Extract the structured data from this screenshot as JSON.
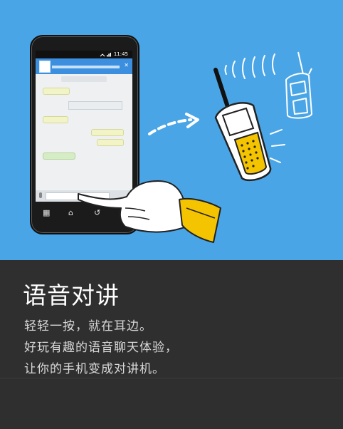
{
  "feature": {
    "title": "语音对讲",
    "description_lines": [
      "轻轻一按，就在耳边。",
      "好玩有趣的语音聊天体验，",
      "让你的手机变成对讲机。"
    ]
  },
  "phone": {
    "status_time": "11:45",
    "softkeys": [
      "▦",
      "⌂",
      "↺"
    ]
  },
  "icons": {
    "walkie_talkie": "walkie-talkie-icon",
    "walkie_talkie_outline": "walkie-talkie-outline-icon",
    "pointing_hand": "pointing-hand-icon",
    "dashed_arrow": "dashed-arrow-icon",
    "signal_waves": "signal-waves-icon"
  },
  "colors": {
    "illustration_bg": "#4aa5e6",
    "panel_bg": "#2f2f2f",
    "accent_yellow": "#f5c400",
    "chat_header": "#3b8fde"
  }
}
